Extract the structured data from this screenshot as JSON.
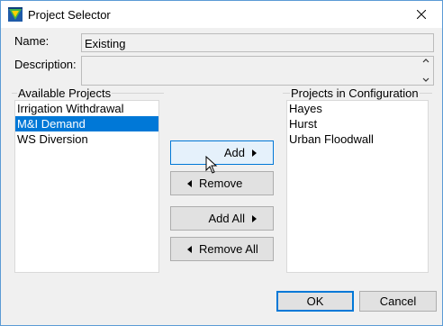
{
  "window": {
    "title": "Project Selector",
    "icon": "app-icon",
    "close_icon": "close-icon"
  },
  "form": {
    "name_label": "Name:",
    "name_value": "Existing",
    "description_label": "Description:",
    "description_value": ""
  },
  "available": {
    "label": "Available Projects",
    "items": [
      {
        "label": "Irrigation Withdrawal",
        "selected": false
      },
      {
        "label": "M&I Demand",
        "selected": true
      },
      {
        "label": "WS Diversion",
        "selected": false
      }
    ]
  },
  "configuration": {
    "label": "Projects in Configuration",
    "items": [
      {
        "label": "Hayes"
      },
      {
        "label": "Hurst"
      },
      {
        "label": "Urban Floodwall"
      }
    ]
  },
  "buttons": {
    "add": "Add",
    "remove": "Remove",
    "add_all": "Add All",
    "remove_all": "Remove All",
    "ok": "OK",
    "cancel": "Cancel"
  },
  "colors": {
    "selection": "#0078d7",
    "window_bg": "#f0f0f0",
    "border": "#5b9bd5"
  }
}
